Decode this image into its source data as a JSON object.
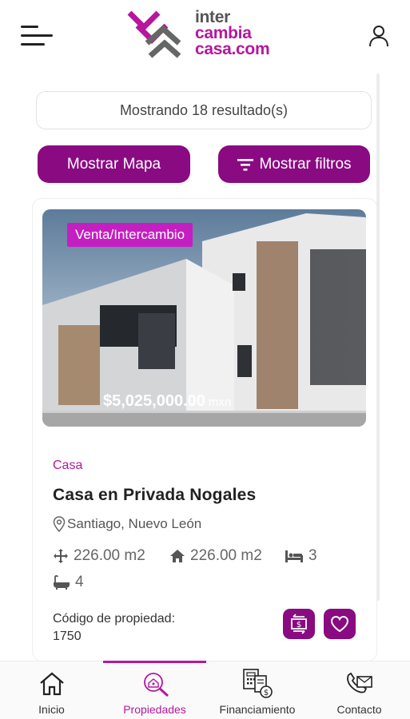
{
  "header": {
    "logo_line1": "inter",
    "logo_line2": "cambia",
    "logo_line3": "casa.com"
  },
  "results": {
    "text": "Mostrando 18 resultado(s)"
  },
  "buttons": {
    "map": "Mostrar Mapa",
    "filters": "Mostrar filtros"
  },
  "listing": {
    "badge": "Venta/Intercambio",
    "price": "$5,025,000.00",
    "currency": "mxn",
    "type": "Casa",
    "title": "Casa en Privada Nogales",
    "location": "Santiago, Nuevo León",
    "lot_area": "226.00 m2",
    "built_area": "226.00 m2",
    "bedrooms": "3",
    "bathrooms": "4",
    "code_label": "Código de propiedad:",
    "code_value": "1750"
  },
  "nav": {
    "items": [
      {
        "label": "Inicio",
        "icon": "home-icon"
      },
      {
        "label": "Propiedades",
        "icon": "property-search-icon"
      },
      {
        "label": "Financiamiento",
        "icon": "financing-icon"
      },
      {
        "label": "Contacto",
        "icon": "contact-icon"
      }
    ],
    "active": "Propiedades"
  },
  "colors": {
    "accent": "#8a0a82",
    "brand_magenta": "#b5179e",
    "badge": "#c41fc0"
  }
}
